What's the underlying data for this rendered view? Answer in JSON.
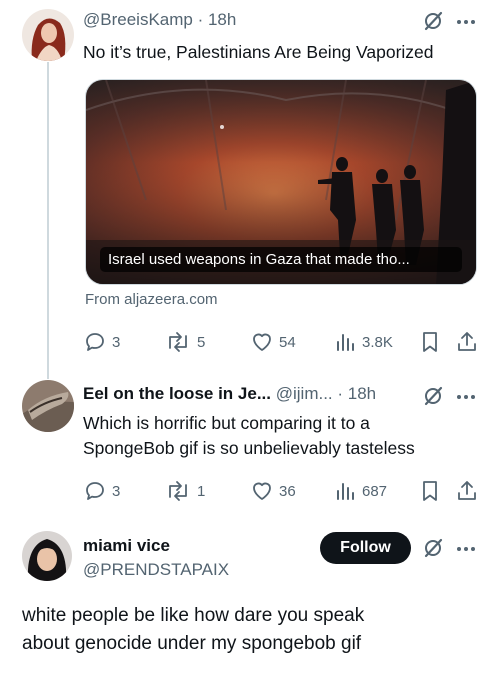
{
  "tweet1": {
    "handle": "@BreeisKamp",
    "time": "· 18h",
    "text": "No it’s true, Palestinians Are Being Vaporized",
    "card": {
      "title": "Israel used weapons in Gaza that made tho...",
      "source": "From aljazeera.com"
    },
    "actions": {
      "replies": "3",
      "reposts": "5",
      "likes": "54",
      "views": "3.8K"
    },
    "icons": [
      "grok-icon",
      "more-icon",
      "reply-icon",
      "repost-icon",
      "like-icon",
      "views-icon",
      "bookmark-icon",
      "share-icon"
    ]
  },
  "tweet2": {
    "name": "Eel on the loose in Je...",
    "handle": "@ijim...",
    "time": "· 18h",
    "text_line1": "Which is horrific but comparing it to a",
    "text_line2": "SpongeBob gif is so unbelievably tasteless",
    "actions": {
      "replies": "3",
      "reposts": "1",
      "likes": "36",
      "views": "687"
    }
  },
  "tweet3": {
    "name": "miami vice",
    "handle": "@PRENDSTAPAIX",
    "follow_label": "Follow",
    "text_line1": "white people be like how dare you speak",
    "text_line2": "about genocide under my spongebob gif"
  },
  "colors": {
    "text": "#0f1419",
    "secondary": "#536471",
    "thread": "#cfd9de",
    "button": "#0f1419"
  }
}
